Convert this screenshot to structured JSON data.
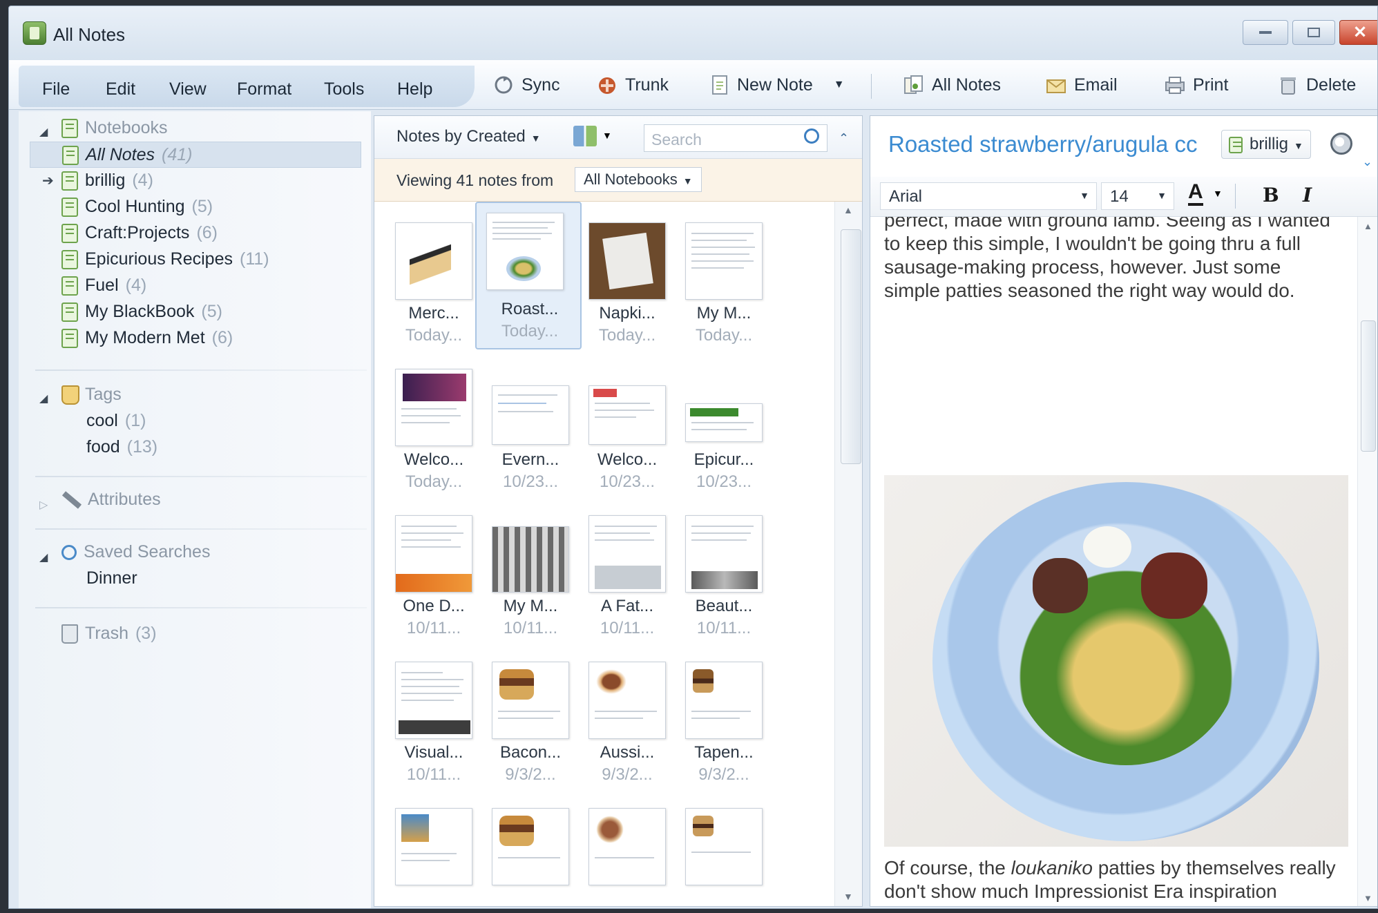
{
  "window": {
    "title": "All Notes"
  },
  "menu": [
    "File",
    "Edit",
    "View",
    "Format",
    "Tools",
    "Help"
  ],
  "toolbar": {
    "sync": "Sync",
    "trunk": "Trunk",
    "new_note": "New Note",
    "all_notes": "All Notes",
    "email": "Email",
    "print": "Print",
    "delete": "Delete"
  },
  "sidebar": {
    "notebooks_header": "Notebooks",
    "notebooks": [
      {
        "label": "All Notes",
        "count": "(41)"
      },
      {
        "label": "brillig",
        "count": "(4)"
      },
      {
        "label": "Cool Hunting",
        "count": "(5)"
      },
      {
        "label": "Craft:Projects",
        "count": "(6)"
      },
      {
        "label": "Epicurious Recipes",
        "count": "(11)"
      },
      {
        "label": "Fuel",
        "count": "(4)"
      },
      {
        "label": "My BlackBook",
        "count": "(5)"
      },
      {
        "label": "My Modern Met",
        "count": "(6)"
      }
    ],
    "tags_header": "Tags",
    "tags": [
      {
        "label": "cool",
        "count": "(1)"
      },
      {
        "label": "food",
        "count": "(13)"
      }
    ],
    "attributes": "Attributes",
    "saved_searches_header": "Saved Searches",
    "saved_searches": [
      "Dinner"
    ],
    "trash": {
      "label": "Trash",
      "count": "(3)"
    }
  },
  "list": {
    "sort": "Notes by Created",
    "search_placeholder": "Search",
    "viewing": "Viewing 41 notes from",
    "notebook_filter": "All Notebooks",
    "notes": [
      {
        "title": "Merc...",
        "date": "Today..."
      },
      {
        "title": "Roast...",
        "date": "Today..."
      },
      {
        "title": "Napki...",
        "date": "Today..."
      },
      {
        "title": "My M...",
        "date": "Today..."
      },
      {
        "title": "Welco...",
        "date": "Today..."
      },
      {
        "title": "Evern...",
        "date": "10/23..."
      },
      {
        "title": "Welco...",
        "date": "10/23..."
      },
      {
        "title": "Epicur...",
        "date": "10/23..."
      },
      {
        "title": "One D...",
        "date": "10/11..."
      },
      {
        "title": "My M...",
        "date": "10/11..."
      },
      {
        "title": "A Fat...",
        "date": "10/11..."
      },
      {
        "title": "Beaut...",
        "date": "10/11..."
      },
      {
        "title": "Visual...",
        "date": "10/11..."
      },
      {
        "title": "Bacon...",
        "date": "9/3/2..."
      },
      {
        "title": "Aussi...",
        "date": "9/3/2..."
      },
      {
        "title": "Tapen...",
        "date": "9/3/2..."
      },
      {
        "title": "",
        "date": ""
      },
      {
        "title": "",
        "date": ""
      },
      {
        "title": "",
        "date": ""
      },
      {
        "title": "",
        "date": ""
      }
    ]
  },
  "editor": {
    "title": "Roasted strawberry/arugula cc",
    "notebook": "brillig",
    "font": "Arial",
    "size": "14",
    "bold": "B",
    "italic": "I",
    "text_top": "perfect, made with ground lamb. Seeing as I wanted to keep this simple, I wouldn't be going thru a full sausage-making process, however. Just some simple patties seasoned the right way would do.",
    "text_bottom_1": "Of course, the ",
    "text_bottom_em": "loukaniko",
    "text_bottom_2": " patties by themselves really don't show much Impressionist Era inspiration (brown lumps, not really art-worthy). I used couscous because it reminds me of the"
  },
  "colors": {
    "accent": "#3b8bd1",
    "notebook_green": "#6da34d"
  }
}
